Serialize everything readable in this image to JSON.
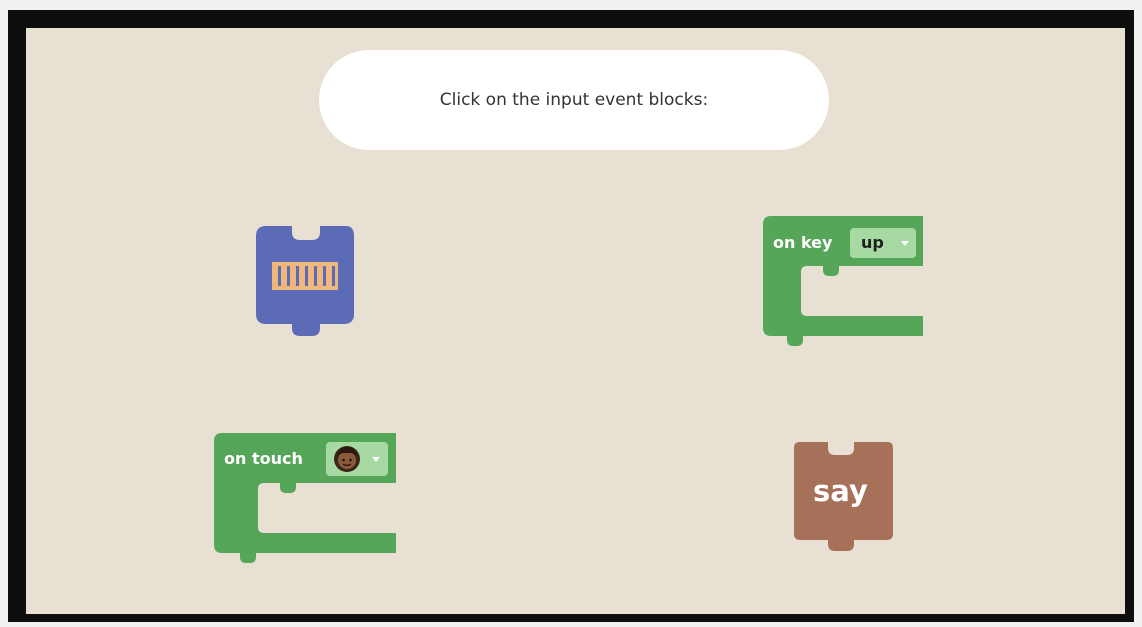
{
  "instruction": {
    "text": "Click on the input event blocks:"
  },
  "blocks": {
    "on_key": {
      "label": "on key",
      "dropdown_value": "up",
      "color": "#56a65a"
    },
    "on_touch": {
      "label": "on touch",
      "dropdown_value": "character-face",
      "color": "#56a65a"
    },
    "say": {
      "label": "say",
      "color": "#a77058"
    },
    "start": {
      "icon": "grid-bars-icon",
      "color": "#5c6bb6"
    }
  },
  "colors": {
    "frame": "#0d0d0d",
    "stage": "#e8e1d3",
    "dropdown_bg": "#a7d9a3",
    "bars": "#f0b77c"
  }
}
